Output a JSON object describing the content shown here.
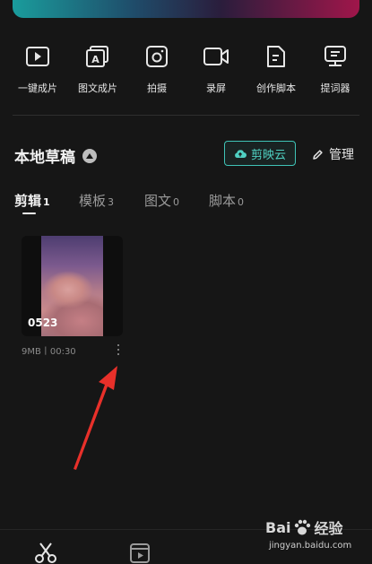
{
  "tools": [
    {
      "icon": "play-icon",
      "label": "一键成片"
    },
    {
      "icon": "image-text-icon",
      "label": "图文成片"
    },
    {
      "icon": "camera-icon",
      "label": "拍摄"
    },
    {
      "icon": "record-icon",
      "label": "录屏"
    },
    {
      "icon": "script-icon",
      "label": "创作脚本"
    },
    {
      "icon": "teleprompter-icon",
      "label": "提词器"
    }
  ],
  "drafts": {
    "title": "本地草稿",
    "cloud_label": "剪映云",
    "manage_label": "管理"
  },
  "tabs": [
    {
      "label": "剪辑",
      "count": "1",
      "active": true
    },
    {
      "label": "模板",
      "count": "3",
      "active": false
    },
    {
      "label": "图文",
      "count": "0",
      "active": false
    },
    {
      "label": "脚本",
      "count": "0",
      "active": false
    }
  ],
  "draft_card": {
    "duration_badge": "0523",
    "meta": "9MB丨00:30"
  },
  "watermark": {
    "brand": "Bai",
    "brand2": "经验",
    "url": "jingyan.baidu.com"
  },
  "colors": {
    "accent": "#3fc3b6",
    "arrow": "#e8302a",
    "background": "#161616"
  }
}
